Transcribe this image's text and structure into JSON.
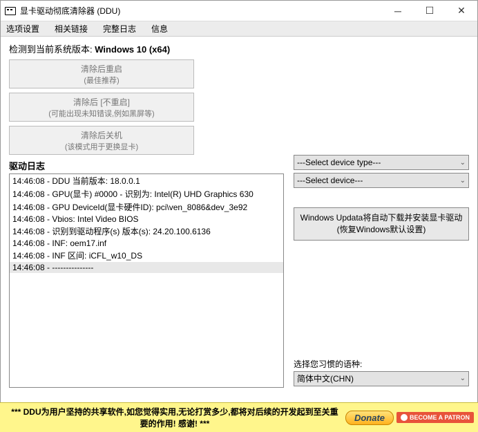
{
  "window": {
    "title": "显卡驱动彻底清除器 (DDU)"
  },
  "menu": {
    "options": "选项设置",
    "links": "相关链接",
    "changelog": "完整日志",
    "info": "信息"
  },
  "system_version": {
    "prefix": "检测到当前系统版本: ",
    "value": "Windows 10 (x64)"
  },
  "buttons": {
    "clean_restart": {
      "line1": "清除后重启",
      "line2": "(最佳推荐)"
    },
    "clean_norestart": {
      "line1": "清除后 [不重启]",
      "line2": "(可能出现未知错误,例如黑屏等)"
    },
    "clean_shutdown": {
      "line1": "清除后关机",
      "line2": "(该模式用于更换显卡)"
    }
  },
  "log": {
    "header": "驱动日志",
    "rows": [
      "14:46:08 - DDU 当前版本: 18.0.0.1",
      "14:46:08 - GPU(显卡) #0000 - 识别为: Intel(R) UHD Graphics 630",
      "14:46:08 - GPU DeviceId(显卡硬件ID): pci\\ven_8086&dev_3e92",
      "14:46:08 - Vbios: Intel Video BIOS",
      "14:46:08 - 识别到驱动程序(s) 版本(s): 24.20.100.6136",
      "14:46:08 - INF: oem17.inf",
      "14:46:08 - INF 区间: iCFL_w10_DS",
      "14:46:08 - ---------------"
    ]
  },
  "selects": {
    "device_type": "---Select device type---",
    "device": "---Select device---"
  },
  "update_button": {
    "line1": "Windows Updata将自动下载并安装显卡驱动",
    "line2": "(恢复Windows默认设置)"
  },
  "language": {
    "label": "选择您习惯的语种:",
    "value": "简体中文(CHN)"
  },
  "footer": {
    "message": "*** DDU为用户坚持的共享软件,如您觉得实用,无论打赏多少,都将对后续的开发起到至关重要的作用! 感谢! ***",
    "donate": "Donate",
    "patron": "BECOME A PATRON"
  }
}
